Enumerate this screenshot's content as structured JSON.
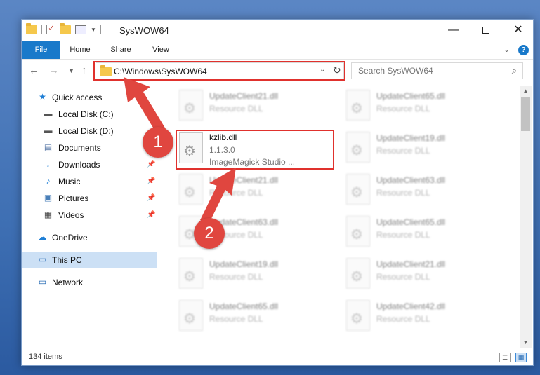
{
  "window": {
    "title": "SysWOW64",
    "controls": {
      "minimize": "—",
      "maximize": "",
      "close": "✕"
    }
  },
  "ribbon": {
    "tabs": [
      {
        "label": "File"
      },
      {
        "label": "Home"
      },
      {
        "label": "Share"
      },
      {
        "label": "View"
      }
    ],
    "help": "?"
  },
  "navigation": {
    "address": "C:\\Windows\\SysWOW64",
    "search_placeholder": "Search SysWOW64"
  },
  "sidebar": {
    "items": [
      {
        "label": "Quick access",
        "icon": "star-icon"
      },
      {
        "label": "Local Disk (C:)",
        "icon": "drive-icon",
        "pinned": true
      },
      {
        "label": "Local Disk (D:)",
        "icon": "drive-icon"
      },
      {
        "label": "Documents",
        "icon": "documents-icon",
        "pinned": true
      },
      {
        "label": "Downloads",
        "icon": "download-icon",
        "pinned": true
      },
      {
        "label": "Music",
        "icon": "music-icon",
        "pinned": true
      },
      {
        "label": "Pictures",
        "icon": "pictures-icon",
        "pinned": true
      },
      {
        "label": "Videos",
        "icon": "videos-icon",
        "pinned": true
      },
      {
        "label": "OneDrive",
        "icon": "cloud-icon"
      },
      {
        "label": "This PC",
        "icon": "computer-icon",
        "selected": true
      },
      {
        "label": "Network",
        "icon": "network-icon"
      }
    ]
  },
  "files": {
    "left_column": [
      {
        "name": "UpdateClient21.dll",
        "desc": "Resource DLL"
      },
      {
        "name": "kzlib.dll",
        "version": "1.1.3.0",
        "desc": "ImageMagick Studio ...",
        "highlighted": true
      },
      {
        "name": "UpdateClient21.dll",
        "desc": "Resource DLL"
      },
      {
        "name": "UpdateClient63.dll",
        "desc": "Resource DLL"
      },
      {
        "name": "UpdateClient19.dll",
        "desc": "Resource DLL"
      },
      {
        "name": "UpdateClient65.dll",
        "desc": "Resource DLL"
      }
    ],
    "right_column": [
      {
        "name": "UpdateClient65.dll",
        "desc": "Resource DLL"
      },
      {
        "name": "UpdateClient19.dll",
        "desc": "Resource DLL"
      },
      {
        "name": "UpdateClient63.dll",
        "desc": "Resource DLL"
      },
      {
        "name": "UpdateClient65.dll",
        "desc": "Resource DLL"
      },
      {
        "name": "UpdateClient21.dll",
        "desc": "Resource DLL"
      },
      {
        "name": "UpdateClient42.dll",
        "desc": "Resource DLL"
      }
    ]
  },
  "status": {
    "item_count": "134 items"
  },
  "annotations": {
    "step1": "1",
    "step2": "2",
    "color": "#e0463f"
  }
}
